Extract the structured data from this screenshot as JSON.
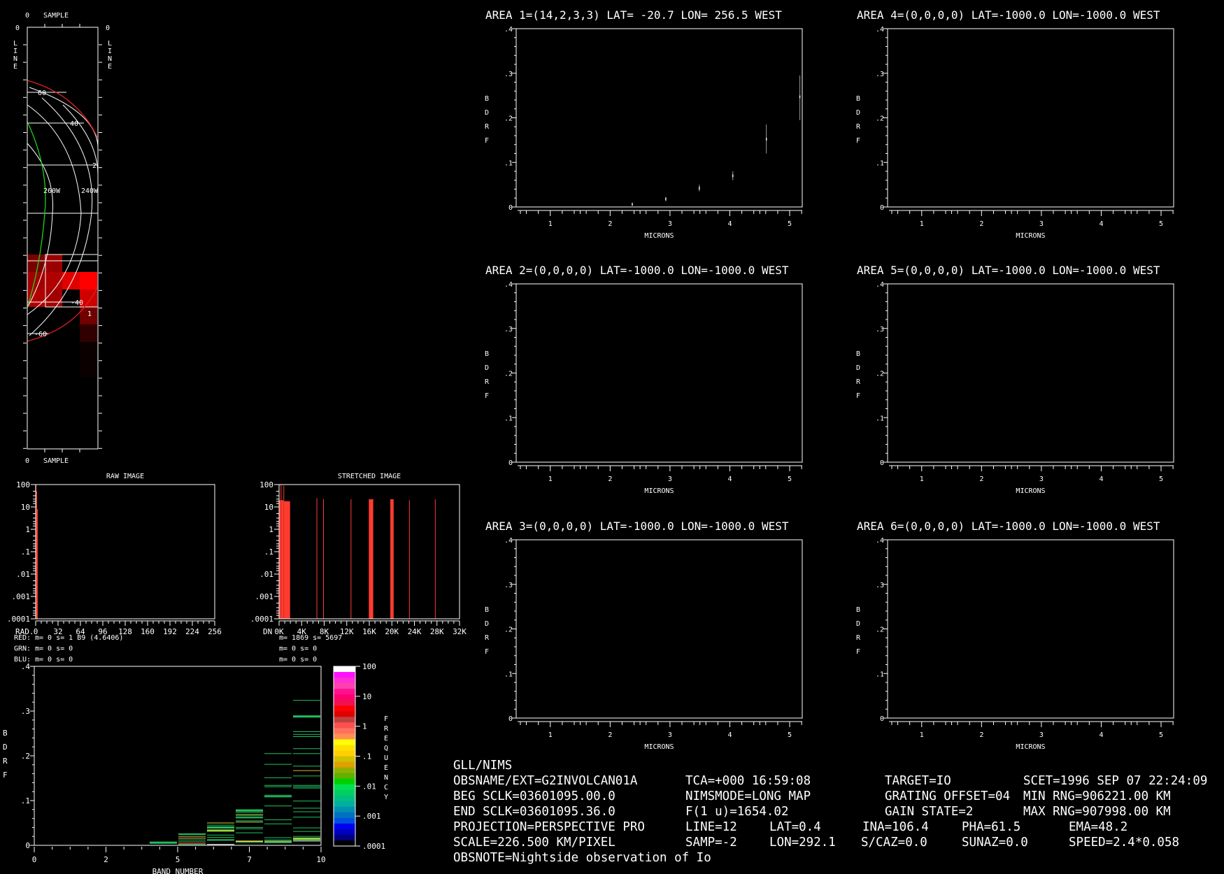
{
  "map": {
    "sample_label_top": "SAMPLE",
    "sample_label_bottom": "SAMPLE",
    "zero_top": "0",
    "zero_bottom": "0",
    "zero_left": "0",
    "zero_right": "0",
    "line_letters": [
      "L",
      "I",
      "N",
      "E"
    ],
    "lat_labels": [
      "60",
      "40",
      "2",
      "-40",
      "-60"
    ],
    "lon_labels": [
      "260W",
      "240W"
    ],
    "area_marker": "1"
  },
  "raw_hist": {
    "title": "RAW IMAGE",
    "axis_prefix": "RAD.",
    "xticks": [
      "0",
      "32",
      "64",
      "96",
      "128",
      "160",
      "192",
      "224",
      "256"
    ],
    "yticks": [
      "100",
      "10",
      "1",
      ".1",
      ".01",
      ".001",
      ".0001"
    ],
    "stats": [
      {
        "label": "RED:",
        "text": "m=    0 s=    1 B9 (4.6406)",
        "color": "#ff2020"
      },
      {
        "label": "GRN:",
        "text": "m=    0 s=    0",
        "color": "#e0e060"
      },
      {
        "label": "BLU:",
        "text": "m=    0 s=    0",
        "color": "#6060ff"
      }
    ]
  },
  "stretch_hist": {
    "title": "STRETCHED IMAGE",
    "axis_prefix": "DN",
    "xticks": [
      "0K",
      "4K",
      "8K",
      "12K",
      "16K",
      "20K",
      "24K",
      "28K",
      "32K"
    ],
    "yticks": [
      "100",
      "10",
      "1",
      ".1",
      ".01",
      ".001",
      ".0001"
    ],
    "stats": [
      "m= 1869 s= 5697",
      "m=    0 s=    0",
      "m=    0 s=    0"
    ]
  },
  "band_chart": {
    "ylabel_letters": [
      "B",
      "D",
      "R",
      "F"
    ],
    "yticks": [
      ".4",
      ".3",
      ".2",
      ".1",
      "0"
    ],
    "xticks": [
      "0",
      "2",
      "5",
      "7",
      "10"
    ],
    "xlabel": "BAND NUMBER"
  },
  "colorbar": {
    "labels": [
      "100",
      "10",
      "1",
      ".1",
      ".01",
      ".001",
      ".0001"
    ],
    "title_letters": [
      "F",
      "R",
      "E",
      "Q",
      "U",
      "E",
      "N",
      "C",
      "Y"
    ],
    "colors": [
      "#ffffff",
      "#ff10ff",
      "#ff30d0",
      "#ff40b0",
      "#ff1090",
      "#ff0070",
      "#f01050",
      "#ff0000",
      "#e00000",
      "#c04040",
      "#ff5050",
      "#ff7060",
      "#ff9050",
      "#ffff00",
      "#ffe000",
      "#ffd000",
      "#d0c000",
      "#e0a000",
      "#90b000",
      "#60b000",
      "#00d000",
      "#00e050",
      "#00d060",
      "#00c080",
      "#00b0a0",
      "#0090b0",
      "#0070c0",
      "#0050e0",
      "#0000f0",
      "#0000c0",
      "#000080",
      "#000000"
    ]
  },
  "areas": [
    {
      "title": "AREA 1=(14,2,3,3) LAT= -20.7 LON= 256.5 WEST"
    },
    {
      "title": "AREA 4=(0,0,0,0) LAT=-1000.0 LON=-1000.0 WEST"
    },
    {
      "title": "AREA 2=(0,0,0,0) LAT=-1000.0 LON=-1000.0 WEST"
    },
    {
      "title": "AREA 5=(0,0,0,0) LAT=-1000.0 LON=-1000.0 WEST"
    },
    {
      "title": "AREA 3=(0,0,0,0) LAT=-1000.0 LON=-1000.0 WEST"
    },
    {
      "title": "AREA 6=(0,0,0,0) LAT=-1000.0 LON=-1000.0 WEST"
    }
  ],
  "area_axes": {
    "ylabel_letters": [
      "B",
      "D",
      "R",
      "F"
    ],
    "yticks": [
      "0",
      ".1",
      ".2",
      ".3",
      ".4"
    ],
    "xticks": [
      "1",
      "2",
      "3",
      "4",
      "5"
    ],
    "xlabel": "MICRONS"
  },
  "info": {
    "header": "GLL/NIMS",
    "obsname": "OBSNAME/EXT=G2INVOLCAN01A",
    "tca": "TCA=+000 16:59:08",
    "target": "TARGET=IO",
    "scet": "SCET=1996 SEP 07 22:24:09",
    "beg_sclk": "BEG SCLK=03601095.00.0",
    "nimsmode": "NIMSMODE=LONG MAP",
    "grating": "GRATING OFFSET=04",
    "min_rng": "MIN RNG=906221.00 KM",
    "end_sclk": "END SCLK=03601095.36.0",
    "f1u": "F(1 u)=1654.02",
    "gain": "GAIN STATE=2",
    "max_rng": "MAX RNG=907998.00 KM",
    "projection": "PROJECTION=PERSPECTIVE PRO",
    "line": "LINE=12",
    "lat": "LAT=0.4",
    "ina": "INA=106.4",
    "pha": "PHA=61.5",
    "ema": "EMA=48.2",
    "scale": "SCALE=226.500 KM/PIXEL",
    "samp": "SAMP=-2",
    "lon": "LON=292.1",
    "scaz": "S/CAZ=0.0",
    "sunaz": "SUNAZ=0.0",
    "speed": "SPEED=2.4*0.058",
    "obsnote": "OBSNOTE=Nightside observation of Io"
  },
  "chart_data": [
    {
      "type": "scatter",
      "title": "AREA 1=(14,2,3,3) LAT= -20.7 LON= 256.5 WEST",
      "xlabel": "MICRONS",
      "ylabel": "BDRF",
      "xlim": [
        0.43,
        5.21
      ],
      "ylim": [
        0,
        0.4
      ],
      "points": [
        {
          "x": 2.37,
          "y": 0.006,
          "lo": 0.004,
          "hi": 0.008
        },
        {
          "x": 2.93,
          "y": 0.018,
          "lo": 0.013,
          "hi": 0.022
        },
        {
          "x": 3.49,
          "y": 0.042,
          "lo": 0.035,
          "hi": 0.05
        },
        {
          "x": 4.05,
          "y": 0.07,
          "lo": 0.06,
          "hi": 0.08
        },
        {
          "x": 4.61,
          "y": 0.152,
          "lo": 0.12,
          "hi": 0.185
        },
        {
          "x": 5.17,
          "y": 0.247,
          "lo": 0.195,
          "hi": 0.295
        }
      ]
    },
    {
      "type": "scatter",
      "title": "AREA 4",
      "xlim": [
        0.43,
        5.21
      ],
      "ylim": [
        0,
        0.4
      ],
      "points": []
    },
    {
      "type": "scatter",
      "title": "AREA 2",
      "xlim": [
        0.43,
        5.21
      ],
      "ylim": [
        0,
        0.4
      ],
      "points": []
    },
    {
      "type": "scatter",
      "title": "AREA 5",
      "xlim": [
        0.43,
        5.21
      ],
      "ylim": [
        0,
        0.4
      ],
      "points": []
    },
    {
      "type": "scatter",
      "title": "AREA 3",
      "xlim": [
        0.43,
        5.21
      ],
      "ylim": [
        0,
        0.4
      ],
      "points": []
    },
    {
      "type": "scatter",
      "title": "AREA 6",
      "xlim": [
        0.43,
        5.21
      ],
      "ylim": [
        0,
        0.4
      ],
      "points": []
    },
    {
      "type": "bar",
      "title": "RAW IMAGE",
      "xlabel": "RAD.",
      "xlim": [
        0,
        256
      ],
      "ylim_log": [
        0.0001,
        100
      ],
      "bars": [
        {
          "x": 0,
          "w": 1,
          "v": 100
        },
        {
          "x": 1,
          "w": 1,
          "v": 50
        },
        {
          "x": 2,
          "w": 1,
          "v": 8
        }
      ]
    },
    {
      "type": "bar",
      "title": "STRETCHED IMAGE",
      "xlabel": "DN",
      "xlim": [
        0,
        32768
      ],
      "ylim_log": [
        0.0001,
        100
      ],
      "bars": [
        {
          "x": 0,
          "w": 300,
          "v": 20
        },
        {
          "x": 300,
          "w": 100,
          "v": 100
        },
        {
          "x": 400,
          "w": 400,
          "v": 20
        },
        {
          "x": 800,
          "w": 100,
          "v": 90
        },
        {
          "x": 900,
          "w": 1100,
          "v": 18
        },
        {
          "x": 6800,
          "w": 80,
          "v": 25
        },
        {
          "x": 8000,
          "w": 80,
          "v": 22
        },
        {
          "x": 13000,
          "w": 80,
          "v": 22
        },
        {
          "x": 16300,
          "w": 800,
          "v": 22
        },
        {
          "x": 20200,
          "w": 600,
          "v": 22
        },
        {
          "x": 23600,
          "w": 80,
          "v": 20
        },
        {
          "x": 28300,
          "w": 80,
          "v": 22
        }
      ]
    },
    {
      "type": "heatmap",
      "title": "BAND NUMBER vs BDRF",
      "xlabel": "BAND NUMBER",
      "ylabel": "BDRF",
      "xlim": [
        0,
        10
      ],
      "ylim": [
        0,
        0.4
      ],
      "segments": [
        {
          "band": 4,
          "values": [
            [
              0.006,
              "#20c060",
              3
            ]
          ]
        },
        {
          "band": 5,
          "values": [
            [
              0.025,
              "#20c060",
              2
            ],
            [
              0.02,
              "#e0a060",
              1
            ],
            [
              0.016,
              "#e0d040",
              1
            ],
            [
              0.012,
              "#20c060",
              1
            ],
            [
              0.008,
              "#20c060",
              1
            ],
            [
              0.004,
              "#c03030",
              2
            ],
            [
              0.002,
              "#20c060",
              1
            ]
          ]
        },
        {
          "band": 6,
          "values": [
            [
              0.05,
              "#e0d040",
              1
            ],
            [
              0.045,
              "#20c060",
              1
            ],
            [
              0.04,
              "#20c060",
              3
            ],
            [
              0.033,
              "#a0d040",
              3
            ],
            [
              0.023,
              "#20c060",
              1
            ],
            [
              0.018,
              "#20c060",
              1
            ],
            [
              0.012,
              "#20c060",
              2
            ],
            [
              0.002,
              "#ffffff",
              1
            ]
          ]
        },
        {
          "band": 7,
          "values": [
            [
              0.078,
              "#20c060",
              3
            ],
            [
              0.074,
              "#20c060",
              1
            ],
            [
              0.069,
              "#e0d040",
              1
            ],
            [
              0.066,
              "#20c060",
              1
            ],
            [
              0.062,
              "#20c060",
              2
            ],
            [
              0.055,
              "#20c060",
              1
            ],
            [
              0.052,
              "#e0d040",
              1
            ],
            [
              0.04,
              "#20c060",
              1
            ],
            [
              0.037,
              "#20c060",
              1
            ],
            [
              0.028,
              "#20c060",
              1
            ],
            [
              0.009,
              "#e0d040",
              2
            ],
            [
              0.007,
              "#20c060",
              1
            ]
          ]
        },
        {
          "band": 8,
          "values": [
            [
              0.205,
              "#20c060",
              1
            ],
            [
              0.181,
              "#20c060",
              1
            ],
            [
              0.151,
              "#20c060",
              1
            ],
            [
              0.134,
              "#20c060",
              1
            ],
            [
              0.131,
              "#20c060",
              1
            ],
            [
              0.112,
              "#20c060",
              1
            ],
            [
              0.109,
              "#20c060",
              2
            ],
            [
              0.088,
              "#20c060",
              1
            ],
            [
              0.057,
              "#20c060",
              1
            ],
            [
              0.048,
              "#20c060",
              1
            ],
            [
              0.017,
              "#20c060",
              1
            ],
            [
              0.012,
              "#20c060",
              1
            ],
            [
              0.008,
              "#80c060",
              3
            ],
            [
              0.006,
              "#20c060",
              1
            ]
          ]
        },
        {
          "band": 9,
          "values": [
            [
              0.324,
              "#20c060",
              1
            ],
            [
              0.288,
              "#20c060",
              3
            ],
            [
              0.254,
              "#20c060",
              1
            ],
            [
              0.248,
              "#20c060",
              1
            ],
            [
              0.243,
              "#20c060",
              1
            ],
            [
              0.216,
              "#20c060",
              1
            ],
            [
              0.205,
              "#20c060",
              1
            ],
            [
              0.177,
              "#20c060",
              1
            ],
            [
              0.167,
              "#e0b040",
              1
            ],
            [
              0.155,
              "#20c060",
              1
            ],
            [
              0.134,
              "#20c060",
              1
            ],
            [
              0.131,
              "#20c060",
              1
            ],
            [
              0.128,
              "#20c060",
              1
            ],
            [
              0.099,
              "#20c060",
              1
            ],
            [
              0.083,
              "#20c060",
              1
            ],
            [
              0.075,
              "#20c060",
              1
            ],
            [
              0.063,
              "#20c060",
              1
            ],
            [
              0.039,
              "#20c060",
              1
            ],
            [
              0.031,
              "#20c060",
              1
            ],
            [
              0.02,
              "#20c060",
              1
            ],
            [
              0.015,
              "#a0d040",
              3
            ],
            [
              0.012,
              "#20c060",
              1
            ],
            [
              0.01,
              "#80a080",
              2
            ]
          ]
        }
      ]
    }
  ]
}
